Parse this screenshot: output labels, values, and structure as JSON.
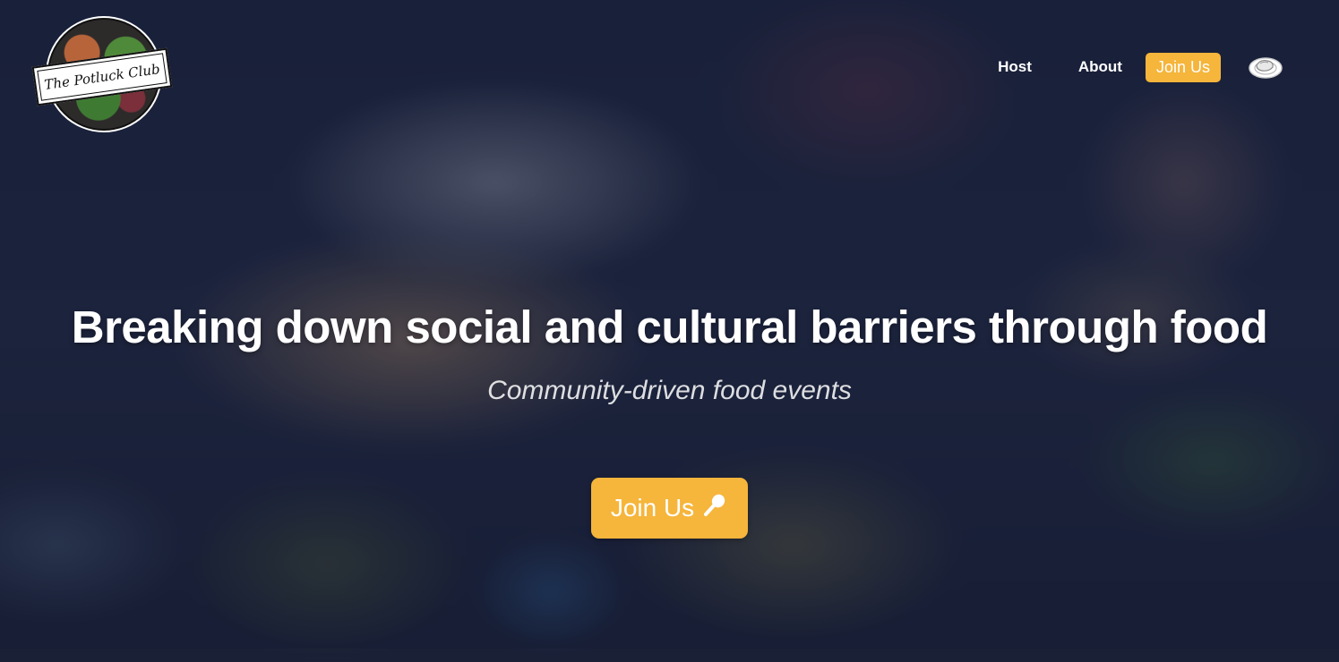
{
  "brand": {
    "logo_text": "The Potluck Club"
  },
  "nav": {
    "host_label": "Host",
    "about_label": "About",
    "join_label": "Join Us",
    "icon": "plate-icon"
  },
  "hero": {
    "headline": "Breaking down social and cultural barriers through food",
    "subheadline": "Community-driven food events",
    "cta_label": "Join Us",
    "cta_icon": "spoon-icon"
  },
  "colors": {
    "accent": "#f6b53b",
    "overlay": "#141a32",
    "text": "#ffffff"
  }
}
